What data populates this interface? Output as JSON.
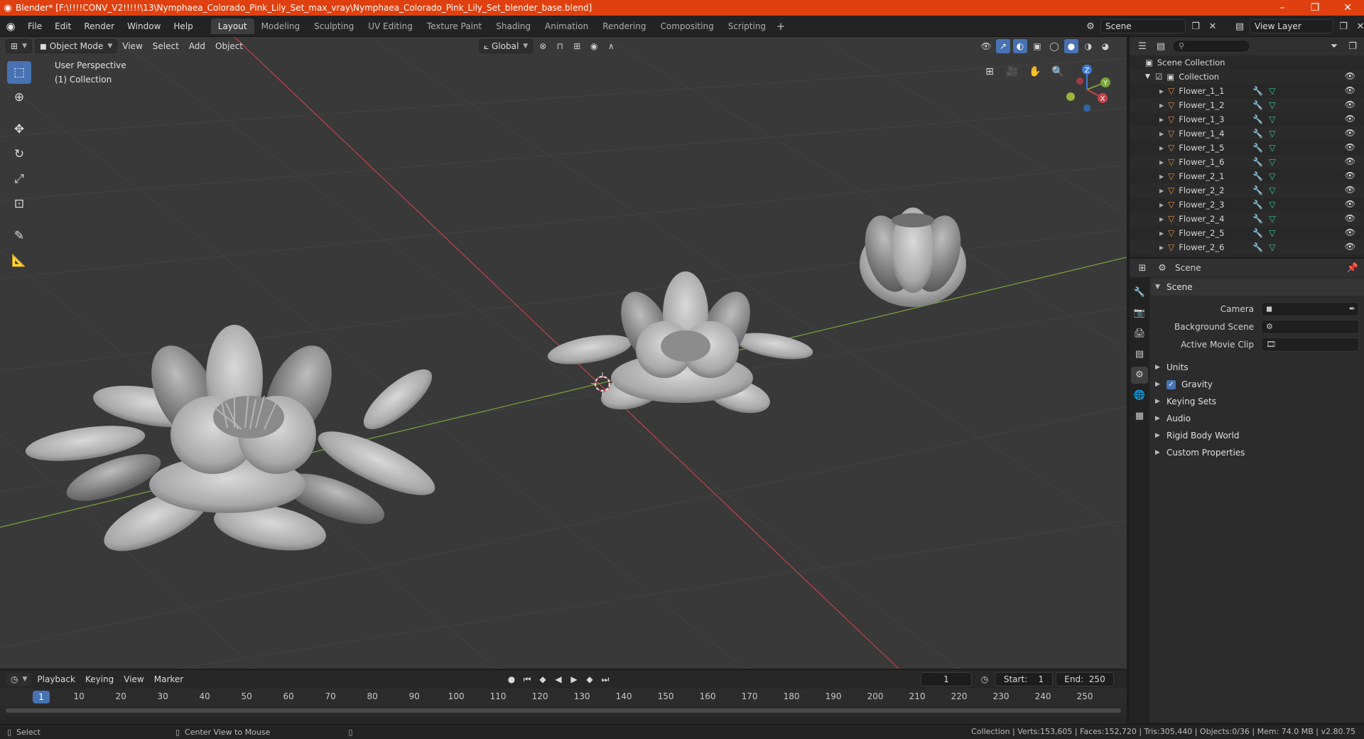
{
  "window": {
    "title": "Blender* [F:\\!!!!CONV_V2!!!!!\\13\\Nymphaea_Colorado_Pink_Lily_Set_max_vray\\Nymphaea_Colorado_Pink_Lily_Set_blender_base.blend]",
    "minimize": "–",
    "maximize": "❐",
    "close": "✕"
  },
  "menu": [
    "File",
    "Edit",
    "Render",
    "Window",
    "Help"
  ],
  "workspaces": [
    "Layout",
    "Modeling",
    "Sculpting",
    "UV Editing",
    "Texture Paint",
    "Shading",
    "Animation",
    "Rendering",
    "Compositing",
    "Scripting"
  ],
  "workspace_add": "+",
  "scene": {
    "name": "Scene",
    "view_layer": "View Layer"
  },
  "viewport": {
    "mode": "Object Mode",
    "menus": [
      "View",
      "Select",
      "Add",
      "Object"
    ],
    "orientation": "Global",
    "perspective_label": "User Perspective",
    "collection_label": "(1) Collection",
    "gizmo": {
      "z": "Z",
      "y": "Y",
      "x": "X"
    }
  },
  "timeline": {
    "menus": [
      "Playback",
      "Keying",
      "View",
      "Marker"
    ],
    "current_frame": "1",
    "start_label": "Start:",
    "start": "1",
    "end_label": "End:",
    "end": "250",
    "ticks": [
      "1",
      "10",
      "20",
      "30",
      "40",
      "50",
      "60",
      "70",
      "80",
      "90",
      "100",
      "110",
      "120",
      "130",
      "140",
      "150",
      "160",
      "170",
      "180",
      "190",
      "200",
      "210",
      "220",
      "230",
      "240",
      "250"
    ]
  },
  "status": {
    "left_action": "Select",
    "mid_action": "Center View to Mouse",
    "stats": "Collection | Verts:153,605 | Faces:152,720 | Tris:305,440 | Objects:0/36 | Mem: 74.0 MB | v2.80.75"
  },
  "outliner": {
    "root": "Scene Collection",
    "collection": "Collection",
    "items": [
      "Flower_1_1",
      "Flower_1_2",
      "Flower_1_3",
      "Flower_1_4",
      "Flower_1_5",
      "Flower_1_6",
      "Flower_2_1",
      "Flower_2_2",
      "Flower_2_3",
      "Flower_2_4",
      "Flower_2_5",
      "Flower_2_6"
    ]
  },
  "properties": {
    "context": "Scene",
    "scene_panel": "Scene",
    "camera_label": "Camera",
    "background_scene_label": "Background Scene",
    "active_clip_label": "Active Movie Clip",
    "panels": [
      "Units",
      "Gravity",
      "Keying Sets",
      "Audio",
      "Rigid Body World",
      "Custom Properties"
    ]
  },
  "colors": {
    "titlebar": "#e0400f",
    "accent": "#4772b3",
    "x_axis": "#c3424d",
    "y_axis": "#7aa33a"
  }
}
